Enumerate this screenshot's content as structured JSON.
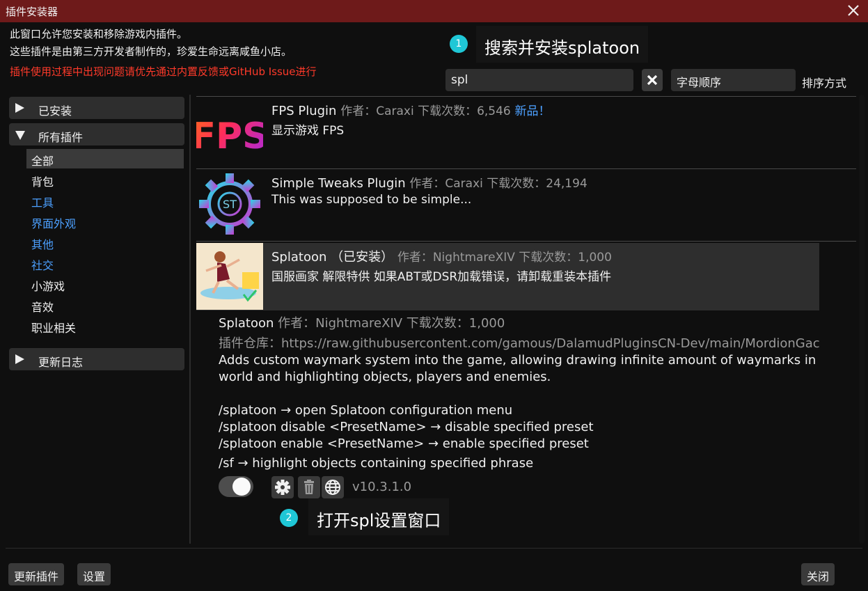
{
  "window": {
    "title": "插件安装器",
    "title_bar_color": "#6e1a1a"
  },
  "description": {
    "line1": "此窗口允许您安装和移除游戏内插件。",
    "line2": "这些插件是由第三方开发者制作的，珍爱生命远离咸鱼小店。",
    "warning": "插件使用过程中出现问题请优先通过内置反馈或GitHub Issue进行"
  },
  "annotations": [
    {
      "number": "1",
      "text": "搜索并安装splatoon"
    },
    {
      "number": "2",
      "text": "打开spl设置窗口"
    }
  ],
  "search": {
    "value": "spl",
    "sort_value": "字母顺序",
    "sort_label": "排序方式",
    "clear_icon": "close-icon"
  },
  "sidebar": {
    "installed": "已安装",
    "all_plugins": "所有插件",
    "categories": [
      {
        "label": "全部"
      },
      {
        "label": "背包"
      },
      {
        "label": "工具"
      },
      {
        "label": "界面外观"
      },
      {
        "label": "其他"
      },
      {
        "label": "社交"
      },
      {
        "label": "小游戏"
      },
      {
        "label": "音效"
      },
      {
        "label": "职业相关"
      }
    ],
    "changelog": "更新日志"
  },
  "plugins": [
    {
      "name": "FPS Plugin",
      "meta": "作者：Caraxi   下载次数：6,546",
      "badge": "新品！",
      "description": "显示游戏 FPS",
      "icon_text": "FPS"
    },
    {
      "name": "Simple Tweaks Plugin",
      "meta": "作者：Caraxi   下载次数：24,194",
      "description": "This was supposed to be simple...",
      "icon_text": "ST"
    },
    {
      "name": "Splatoon （已安装）",
      "meta": "作者：NightmareXIV   下载次数：1,000",
      "description": "国服画家 解限特供 如果ABT或DSR加载错误，请卸载重装本插件"
    }
  ],
  "detail": {
    "name": "Splatoon",
    "meta": "作者：NightmareXIV   下载次数：1,000",
    "repo": "插件仓库：https://raw.githubusercontent.com/gamous/DalamudPluginsCN-Dev/main/MordionGac",
    "desc1": "Adds custom waymark system into the game, allowing drawing infinite amount of waymarks in",
    "desc2": "world and highlighting objects, players and enemies.",
    "cmd1": "/splatoon → open Splatoon configuration menu",
    "cmd2": "/splatoon disable <PresetName> → disable specified preset",
    "cmd3": "/splatoon enable <PresetName> → enable specified preset",
    "cmd4": "/sf → highlight objects containing specified phrase",
    "version": "v10.3.1.0",
    "enabled": true
  },
  "footer": {
    "update_button": "更新插件",
    "settings_button": "设置",
    "close_button": "关闭"
  },
  "colors": {
    "accent_blue": "#4ca0ff",
    "warning_red": "#ff3a2a",
    "badge_cyan": "#1fc7d6"
  }
}
